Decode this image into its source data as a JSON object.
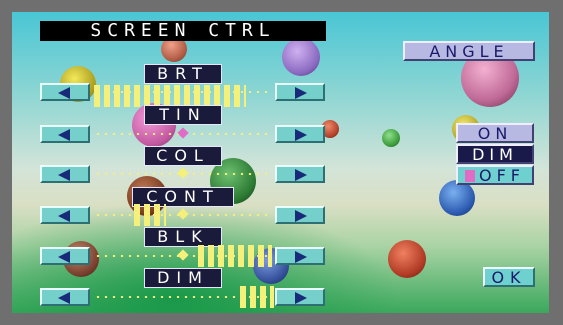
{
  "title": "SCREEN CTRL",
  "controls": [
    {
      "label": "BRT",
      "value_percent": 45
    },
    {
      "label": "TIN",
      "value_percent": 50
    },
    {
      "label": "COL",
      "value_percent": 50
    },
    {
      "label": "CONT",
      "value_percent": 25
    },
    {
      "label": "BLK",
      "value_percent": 60
    },
    {
      "label": "DIM",
      "value_percent": 85
    }
  ],
  "side": {
    "angle": "ANGLE",
    "on": "ON",
    "dim": "DIM",
    "off": "OFF",
    "ok": "OK"
  },
  "icons": {
    "decrease": "left-arrow-icon",
    "increase": "right-arrow-icon"
  },
  "colors": {
    "bar": "#f4f07a",
    "tint_marker": "#e06cc6",
    "marker": "#f4f07a",
    "arrow_button": "#75cfcb"
  }
}
